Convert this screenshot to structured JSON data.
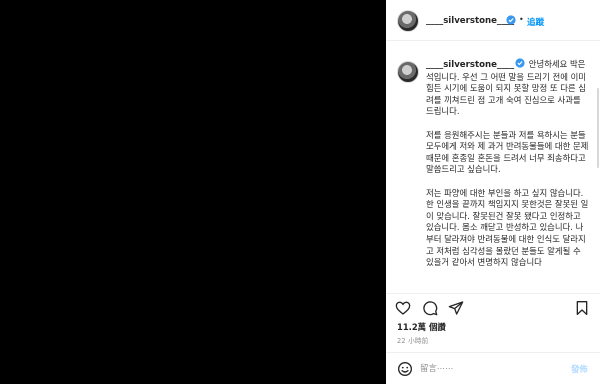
{
  "post": {
    "username": "____silverstone____",
    "follow_label": "追蹤",
    "separator": "•",
    "caption": {
      "greeting": " 안녕하세요 박은석입니다. 우선 그 어떤 말을 드리기 전에 이미 힘든 시기에 도움이 되지 못할 망정 또 다른 심려를 끼쳐드린 점 고개 숙여 진심으로 사과를 드립니다.",
      "paragraphs": [
        "저를 응원해주시는 분들과 저를 욕하시는 분들 모두에게 저와 제 과거 반려동물들에 대한 문제 때문에 혼종일 혼돈을 드려서 너무 죄송하다고 말씀드리고 싶습니다.",
        "저는 파양에 대한 부인을 하고 싶지 않습니다. 한 인생을 끝까지 책임지지 못한것은 잘못된 일이 맞습니다. 잘못된건 잘못 됐다고 인정하고 있습니다. 몸소 깨닫고 반성하고 있습니다. 나부터 달라져야 반려동물에 대한 인식도 달라지고 저처럼 심각성을 몰랐던 분들도 알게될 수 있을거 같아서 변명하지 않습니다"
      ]
    },
    "likes": "11.2萬 個讚",
    "time": "22 小時前",
    "comment_placeholder": "留言⋯⋯",
    "post_label": "發佈"
  },
  "icons": {
    "verified": "verified-badge-icon",
    "like": "heart-icon",
    "comment": "comment-bubble-icon",
    "share": "paper-plane-icon",
    "save": "bookmark-icon",
    "emoji": "smiley-icon"
  },
  "colors": {
    "accent": "#0095f6",
    "text": "#262626",
    "muted": "#8e8e8e",
    "post_disabled": "#b3dbff"
  }
}
